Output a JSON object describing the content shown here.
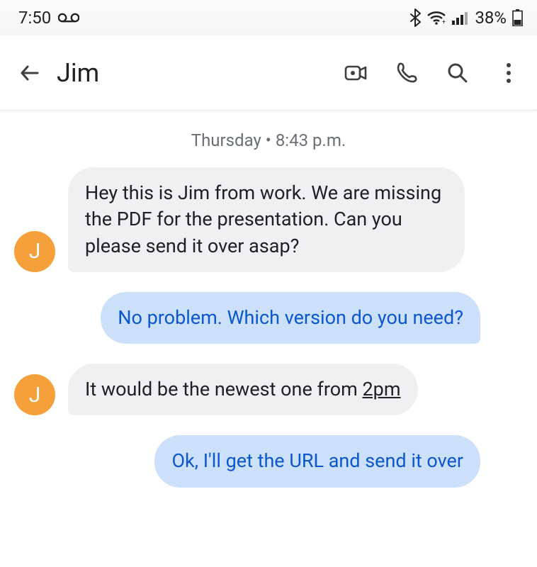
{
  "status": {
    "time": "7:50",
    "battery": "38%"
  },
  "toolbar": {
    "contact_name": "Jim"
  },
  "datesep": "Thursday • 8:43 p.m.",
  "contact_initial": "J",
  "messages": {
    "m0": "Hey this is Jim from work. We are missing the PDF for the presentation. Can you please send it over asap?",
    "m1": "No problem. Which version do you need?",
    "m2a": "It would be the newest one from ",
    "m2b": "2pm",
    "m3": "Ok, I'll get the URL and send it over"
  }
}
